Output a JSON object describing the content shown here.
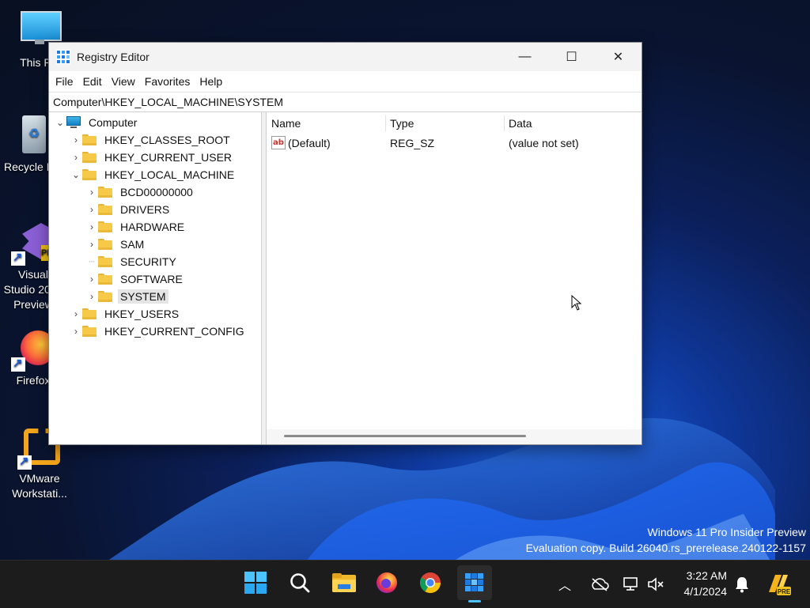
{
  "desktop": {
    "icons": [
      {
        "label": "This PC"
      },
      {
        "label": "Recycle Bin"
      },
      {
        "label": "Visual Studio 2022 Preview"
      },
      {
        "label": "Firefox"
      },
      {
        "label": "VMware Workstati..."
      }
    ]
  },
  "window": {
    "title": "Registry Editor",
    "controls": {
      "minimize": "—",
      "maximize": "☐",
      "close": "✕"
    },
    "menu": [
      "File",
      "Edit",
      "View",
      "Favorites",
      "Help"
    ],
    "address": "Computer\\HKEY_LOCAL_MACHINE\\SYSTEM",
    "tree": {
      "root": "Computer",
      "hives": [
        "HKEY_CLASSES_ROOT",
        "HKEY_CURRENT_USER",
        "HKEY_LOCAL_MACHINE",
        "HKEY_USERS",
        "HKEY_CURRENT_CONFIG"
      ],
      "hklm_children": [
        "BCD00000000",
        "DRIVERS",
        "HARDWARE",
        "SAM",
        "SECURITY",
        "SOFTWARE",
        "SYSTEM"
      ],
      "selected": "SYSTEM"
    },
    "columns": {
      "name": "Name",
      "type": "Type",
      "data": "Data"
    },
    "values": [
      {
        "name": "(Default)",
        "type": "REG_SZ",
        "data": "(value not set)"
      }
    ]
  },
  "watermark": {
    "line1": "Windows 11 Pro Insider Preview",
    "line2": "Evaluation copy. Build 26040.rs_prerelease.240122-1157"
  },
  "taskbar": {
    "apps": [
      "start-icon",
      "search-icon",
      "file-explorer-icon",
      "firefox-icon",
      "chrome-icon",
      "registry-editor-icon"
    ],
    "clock": {
      "time": "3:22 AM",
      "date": "4/1/2024"
    }
  },
  "colors": {
    "accent": "#4cc2ff",
    "folder": "#f7c948",
    "selection": "#e5e5e5"
  }
}
